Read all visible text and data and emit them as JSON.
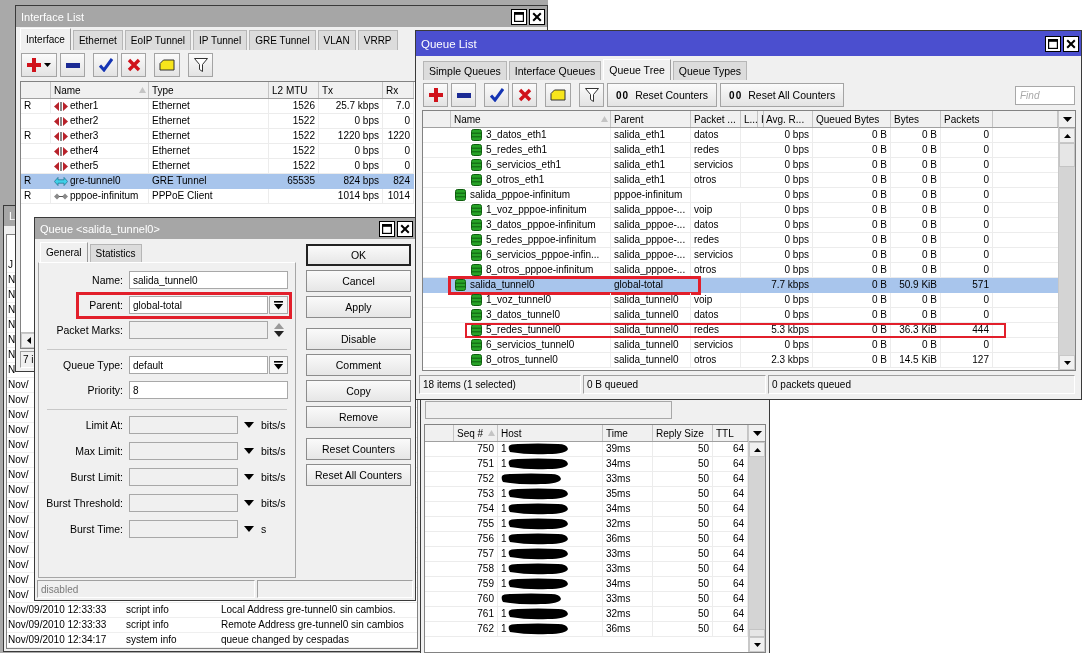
{
  "interface_list": {
    "title": "Interface List",
    "tabs": [
      {
        "label": "Interface",
        "selected": true
      },
      {
        "label": "Ethernet",
        "selected": false
      },
      {
        "label": "EoIP Tunnel",
        "selected": false
      },
      {
        "label": "IP Tunnel",
        "selected": false
      },
      {
        "label": "GRE Tunnel",
        "selected": false
      },
      {
        "label": "VLAN",
        "selected": false
      },
      {
        "label": "VRRP",
        "selected": false
      }
    ],
    "columns": [
      {
        "label": "Name",
        "sorted": true
      },
      {
        "label": "Type",
        "sorted": false
      },
      {
        "label": "L2 MTU",
        "sorted": false
      },
      {
        "label": "Tx",
        "sorted": false
      },
      {
        "label": "Rx",
        "sorted": false
      }
    ],
    "rows": [
      {
        "flag": "R",
        "kind": "ethernet",
        "name": "ether1",
        "type": "Ethernet",
        "l2_mtu": "1526",
        "tx": "25.7 kbps",
        "rx": "7.0",
        "selected": false
      },
      {
        "kind": "ethernet",
        "name": "ether2",
        "type": "Ethernet",
        "l2_mtu": "1522",
        "tx": "0 bps",
        "rx": "0",
        "selected": false
      },
      {
        "flag": "R",
        "kind": "ethernet",
        "name": "ether3",
        "type": "Ethernet",
        "l2_mtu": "1522",
        "tx": "1220 bps",
        "rx": "1220",
        "selected": false
      },
      {
        "kind": "ethernet",
        "name": "ether4",
        "type": "Ethernet",
        "l2_mtu": "1522",
        "tx": "0 bps",
        "rx": "0",
        "selected": false
      },
      {
        "kind": "ethernet",
        "name": "ether5",
        "type": "Ethernet",
        "l2_mtu": "1522",
        "tx": "0 bps",
        "rx": "0",
        "selected": false
      },
      {
        "flag": "R",
        "kind": "tunnel",
        "name": "gre-tunnel0",
        "type": "GRE Tunnel",
        "l2_mtu": "65535",
        "tx": "824 bps",
        "rx": "824",
        "selected": true
      },
      {
        "flag": "R",
        "kind": "pppoe",
        "name": "pppoe-infinitum",
        "type": "PPPoE Client",
        "tx": "1014 bps",
        "rx": "1014",
        "selected": false
      }
    ],
    "status": "7 i"
  },
  "log": {
    "title": "L",
    "rows": [
      {
        "time": "J"
      },
      {
        "time": "N"
      },
      {
        "time": "N"
      },
      {
        "time": "N"
      },
      {
        "time": "N"
      },
      {
        "time": "N"
      },
      {
        "time": "N"
      },
      {
        "time": "N"
      },
      {
        "time": "Nov/"
      },
      {
        "time": "Nov/"
      },
      {
        "time": "Nov/"
      },
      {
        "time": "Nov/"
      },
      {
        "time": "Nov/"
      },
      {
        "time": "Nov/"
      },
      {
        "time": "Nov/"
      },
      {
        "time": "Nov/"
      },
      {
        "time": "Nov/"
      },
      {
        "time": "Nov/"
      },
      {
        "time": "Nov/"
      },
      {
        "time": "Nov/"
      },
      {
        "time": "Nov/"
      },
      {
        "time": "Nov/"
      },
      {
        "time": "Nov/"
      },
      {
        "time": "Nov/09/2010 12:33:33",
        "topics": "script info",
        "message": "Local Address gre-tunnel0 sin cambios."
      },
      {
        "time": "Nov/09/2010 12:33:33",
        "topics": "script info",
        "message": "Remote Address gre-tunnel0 sin cambios"
      },
      {
        "time": "Nov/09/2010 12:34:17",
        "topics": "system info",
        "message": "queue changed by cespadas"
      }
    ]
  },
  "queue_dialog": {
    "title": "Queue <salida_tunnel0>",
    "tabs": [
      {
        "label": "General",
        "selected": true
      },
      {
        "label": "Statistics",
        "selected": false
      }
    ],
    "field_groups": [
      [
        {
          "kind": "text",
          "label": "Name:",
          "value": "salida_tunnel0",
          "highlighted": false
        },
        {
          "kind": "select",
          "label": "Parent:",
          "value": "global-total",
          "highlighted": true
        },
        {
          "kind": "spinner",
          "label": "Packet Marks:",
          "highlighted": false
        }
      ],
      [
        {
          "kind": "select",
          "label": "Queue Type:",
          "value": "default",
          "highlighted": false
        },
        {
          "kind": "text",
          "label": "Priority:",
          "value": "8",
          "highlighted": false
        }
      ],
      [
        {
          "kind": "rate",
          "label": "Limit At:",
          "unit": "bits/s",
          "highlighted": false
        },
        {
          "kind": "rate",
          "label": "Max Limit:",
          "unit": "bits/s",
          "highlighted": false
        },
        {
          "kind": "rate",
          "label": "Burst Limit:",
          "unit": "bits/s",
          "highlighted": false
        },
        {
          "kind": "rate",
          "label": "Burst Threshold:",
          "unit": "bits/s",
          "highlighted": false
        },
        {
          "kind": "rate",
          "label": "Burst Time:",
          "unit": "s",
          "highlighted": false
        }
      ]
    ],
    "button_groups": [
      [
        {
          "label": "OK",
          "default": true
        },
        {
          "label": "Cancel",
          "default": false
        },
        {
          "label": "Apply",
          "default": false
        }
      ],
      [
        {
          "label": "Disable",
          "default": false
        },
        {
          "label": "Comment",
          "default": false
        },
        {
          "label": "Copy",
          "default": false
        },
        {
          "label": "Remove",
          "default": false
        }
      ],
      [
        {
          "label": "Reset Counters",
          "default": false
        },
        {
          "label": "Reset All Counters",
          "default": false
        }
      ]
    ],
    "status": "disabled"
  },
  "queue_list": {
    "title": "Queue List",
    "tabs": [
      {
        "label": "Simple Queues",
        "selected": false
      },
      {
        "label": "Interface Queues",
        "selected": false
      },
      {
        "label": "Queue Tree",
        "selected": true
      },
      {
        "label": "Queue Types",
        "selected": false
      }
    ],
    "toolbar_buttons": [
      {
        "icon_text": "00",
        "label": "Reset Counters"
      },
      {
        "icon_text": "00",
        "label": "Reset All Counters"
      }
    ],
    "search": {
      "placeholder": "Find"
    },
    "columns": [
      {
        "label": "Name",
        "sorted": true
      },
      {
        "label": "Parent",
        "sorted": false
      },
      {
        "label": "Packet ...",
        "sorted": false
      },
      {
        "label": "L...",
        "sorted": false
      },
      {
        "label": "I",
        "sorted": false
      },
      {
        "label": "Avg. R...",
        "sorted": false
      },
      {
        "label": "Queued Bytes",
        "sorted": false
      },
      {
        "label": "Bytes",
        "sorted": false
      },
      {
        "label": "Packets",
        "sorted": false
      }
    ],
    "rows": [
      {
        "children": [
          {
            "name": "3_datos_eth1",
            "parent": "salida_eth1",
            "packet_marks": "datos",
            "avg_rate": "0 bps",
            "queued_bytes": "0 B",
            "bytes": "0 B",
            "packets": "0",
            "selected": false,
            "highlighted": false
          },
          {
            "name": "5_redes_eth1",
            "parent": "salida_eth1",
            "packet_marks": "redes",
            "avg_rate": "0 bps",
            "queued_bytes": "0 B",
            "bytes": "0 B",
            "packets": "0",
            "selected": false,
            "highlighted": false
          },
          {
            "name": "6_servicios_eth1",
            "parent": "salida_eth1",
            "packet_marks": "servicios",
            "avg_rate": "0 bps",
            "queued_bytes": "0 B",
            "bytes": "0 B",
            "packets": "0",
            "selected": false,
            "highlighted": false
          },
          {
            "name": "8_otros_eth1",
            "parent": "salida_eth1",
            "packet_marks": "otros",
            "avg_rate": "0 bps",
            "queued_bytes": "0 B",
            "bytes": "0 B",
            "packets": "0",
            "selected": false,
            "highlighted": false
          }
        ]
      },
      {
        "name": "salida_pppoe-infinitum",
        "parent": "pppoe-infinitum",
        "avg_rate": "0 bps",
        "queued_bytes": "0 B",
        "bytes": "0 B",
        "packets": "0",
        "selected": false,
        "highlighted": false,
        "children": [
          {
            "name": "1_voz_pppoe-infinitum",
            "parent": "salida_pppoe-...",
            "packet_marks": "voip",
            "avg_rate": "0 bps",
            "queued_bytes": "0 B",
            "bytes": "0 B",
            "packets": "0",
            "selected": false,
            "highlighted": false
          },
          {
            "name": "3_datos_pppoe-infinitum",
            "parent": "salida_pppoe-...",
            "packet_marks": "datos",
            "avg_rate": "0 bps",
            "queued_bytes": "0 B",
            "bytes": "0 B",
            "packets": "0",
            "selected": false,
            "highlighted": false
          },
          {
            "name": "5_redes_pppoe-infinitum",
            "parent": "salida_pppoe-...",
            "packet_marks": "redes",
            "avg_rate": "0 bps",
            "queued_bytes": "0 B",
            "bytes": "0 B",
            "packets": "0",
            "selected": false,
            "highlighted": false
          },
          {
            "name": "6_servicios_pppoe-infin...",
            "parent": "salida_pppoe-...",
            "packet_marks": "servicios",
            "avg_rate": "0 bps",
            "queued_bytes": "0 B",
            "bytes": "0 B",
            "packets": "0",
            "selected": false,
            "highlighted": false
          },
          {
            "name": "8_otros_pppoe-infinitum",
            "parent": "salida_pppoe-...",
            "packet_marks": "otros",
            "avg_rate": "0 bps",
            "queued_bytes": "0 B",
            "bytes": "0 B",
            "packets": "0",
            "selected": false,
            "highlighted": false
          }
        ]
      },
      {
        "name": "salida_tunnel0",
        "parent": "global-total",
        "avg_rate": "7.7 kbps",
        "queued_bytes": "0 B",
        "bytes": "50.9 KiB",
        "packets": "571",
        "selected": true,
        "highlighted": true,
        "children": [
          {
            "name": "1_voz_tunnel0",
            "parent": "salida_tunnel0",
            "packet_marks": "voip",
            "avg_rate": "0 bps",
            "queued_bytes": "0 B",
            "bytes": "0 B",
            "packets": "0",
            "selected": false,
            "highlighted": false
          },
          {
            "name": "3_datos_tunnel0",
            "parent": "salida_tunnel0",
            "packet_marks": "datos",
            "avg_rate": "0 bps",
            "queued_bytes": "0 B",
            "bytes": "0 B",
            "packets": "0",
            "selected": false,
            "highlighted": false
          },
          {
            "name": "5_redes_tunnel0",
            "parent": "salida_tunnel0",
            "packet_marks": "redes",
            "avg_rate": "5.3 kbps",
            "queued_bytes": "0 B",
            "bytes": "36.3 KiB",
            "packets": "444",
            "selected": false,
            "highlighted": true
          },
          {
            "name": "6_servicios_tunnel0",
            "parent": "salida_tunnel0",
            "packet_marks": "servicios",
            "avg_rate": "0 bps",
            "queued_bytes": "0 B",
            "bytes": "0 B",
            "packets": "0",
            "selected": false,
            "highlighted": false
          },
          {
            "name": "8_otros_tunnel0",
            "parent": "salida_tunnel0",
            "packet_marks": "otros",
            "avg_rate": "2.3 kbps",
            "queued_bytes": "0 B",
            "bytes": "14.5 KiB",
            "packets": "127",
            "selected": false,
            "highlighted": false
          }
        ]
      }
    ],
    "status": [
      "18 items (1 selected)",
      "0 B queued",
      "0 packets queued"
    ]
  },
  "ping": {
    "columns": [
      {
        "label": "Seq #",
        "sorted": true
      },
      {
        "label": "Host",
        "sorted": false
      },
      {
        "label": "Time",
        "sorted": false
      },
      {
        "label": "Reply Size",
        "sorted": false
      },
      {
        "label": "TTL",
        "sorted": false
      }
    ],
    "rows": [
      {
        "seq": "750",
        "host": "1",
        "redacted": true,
        "time": "39ms",
        "reply_size": "50",
        "ttl": "64"
      },
      {
        "seq": "751",
        "host": "1",
        "redacted": true,
        "time": "34ms",
        "reply_size": "50",
        "ttl": "64"
      },
      {
        "seq": "752",
        "redacted": true,
        "time": "33ms",
        "reply_size": "50",
        "ttl": "64"
      },
      {
        "seq": "753",
        "host": "1",
        "redacted": true,
        "time": "35ms",
        "reply_size": "50",
        "ttl": "64"
      },
      {
        "seq": "754",
        "host": "1",
        "redacted": true,
        "time": "34ms",
        "reply_size": "50",
        "ttl": "64"
      },
      {
        "seq": "755",
        "host": "1",
        "redacted": true,
        "time": "32ms",
        "reply_size": "50",
        "ttl": "64"
      },
      {
        "seq": "756",
        "host": "1",
        "redacted": true,
        "time": "36ms",
        "reply_size": "50",
        "ttl": "64"
      },
      {
        "seq": "757",
        "host": "1",
        "redacted": true,
        "time": "33ms",
        "reply_size": "50",
        "ttl": "64"
      },
      {
        "seq": "758",
        "host": "1",
        "redacted": true,
        "time": "33ms",
        "reply_size": "50",
        "ttl": "64"
      },
      {
        "seq": "759",
        "host": "1",
        "redacted": true,
        "time": "34ms",
        "reply_size": "50",
        "ttl": "64"
      },
      {
        "seq": "760",
        "redacted": true,
        "time": "33ms",
        "reply_size": "50",
        "ttl": "64"
      },
      {
        "seq": "761",
        "host": "1",
        "redacted": true,
        "time": "32ms",
        "reply_size": "50",
        "ttl": "64"
      },
      {
        "seq": "762",
        "host": "1",
        "redacted": true,
        "time": "36ms",
        "reply_size": "50",
        "ttl": "64"
      }
    ]
  }
}
